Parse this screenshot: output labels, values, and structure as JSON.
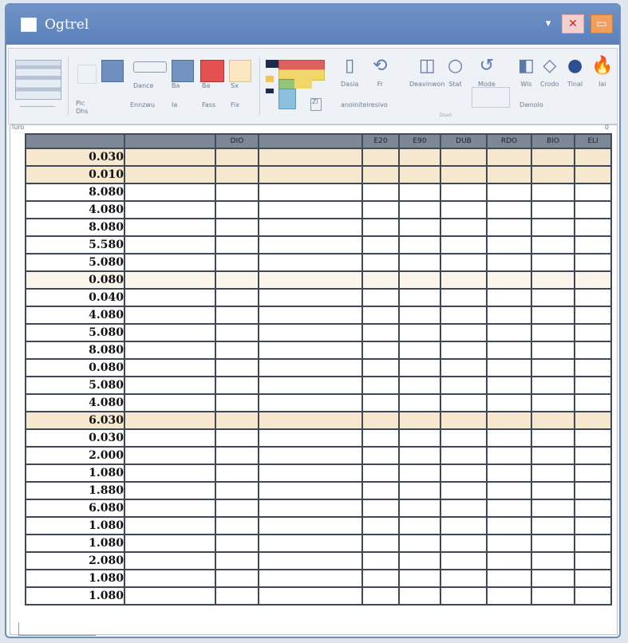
{
  "window": {
    "title": "Ogtrel"
  },
  "titlebar": {
    "min_glyph": "▾",
    "close_glyph": "✕",
    "restore_glyph": "▭"
  },
  "ribbon": {
    "group1": {
      "l1": "Pic",
      "l2": "Dhs"
    },
    "group2": {
      "tile_labels": [
        "Dance",
        "Ba",
        "Ba",
        "Sx"
      ],
      "sub_labels": [
        "Ennzwu",
        "Ia",
        "Fass",
        "Fix"
      ]
    },
    "group3": {
      "caption": "Zl"
    },
    "group4": {
      "buttons": [
        {
          "label": "Dasia",
          "glyph": "▯"
        },
        {
          "label": "Fr",
          "glyph": "⟲"
        },
        {
          "label": "Deavinwon",
          "glyph": "◫"
        },
        {
          "label": "Stat",
          "glyph": "○"
        },
        {
          "label": "Mode",
          "glyph": "↺"
        },
        {
          "label": "Wis",
          "glyph": "◧"
        },
        {
          "label": "Crodo",
          "glyph": "◇"
        },
        {
          "label": "Tinal",
          "glyph": "●"
        },
        {
          "label": "Iai",
          "glyph": "🔥"
        }
      ],
      "caption1": "anoiniteiresivo",
      "caption2": "Dwnolo",
      "caption3": "Dsao"
    }
  },
  "sheet": {
    "corner_left": "luro",
    "corner_right": "0",
    "headers": [
      "",
      "",
      "DIO",
      "",
      "E20",
      "E90",
      "DUB",
      "RDO",
      "BIO",
      "ELI"
    ],
    "row_values": [
      "0.030",
      "0.010",
      "8.080",
      "4.080",
      "8.080",
      "5.580",
      "5.080",
      "0.080",
      "0.040",
      "4.080",
      "5.080",
      "8.080",
      "0.080",
      "5.080",
      "4.080",
      "6.030",
      "0.030",
      "2.000",
      "1.080",
      "1.880",
      "6.080",
      "1.080",
      "1.080",
      "2.080",
      "1.080",
      "1.080"
    ]
  }
}
